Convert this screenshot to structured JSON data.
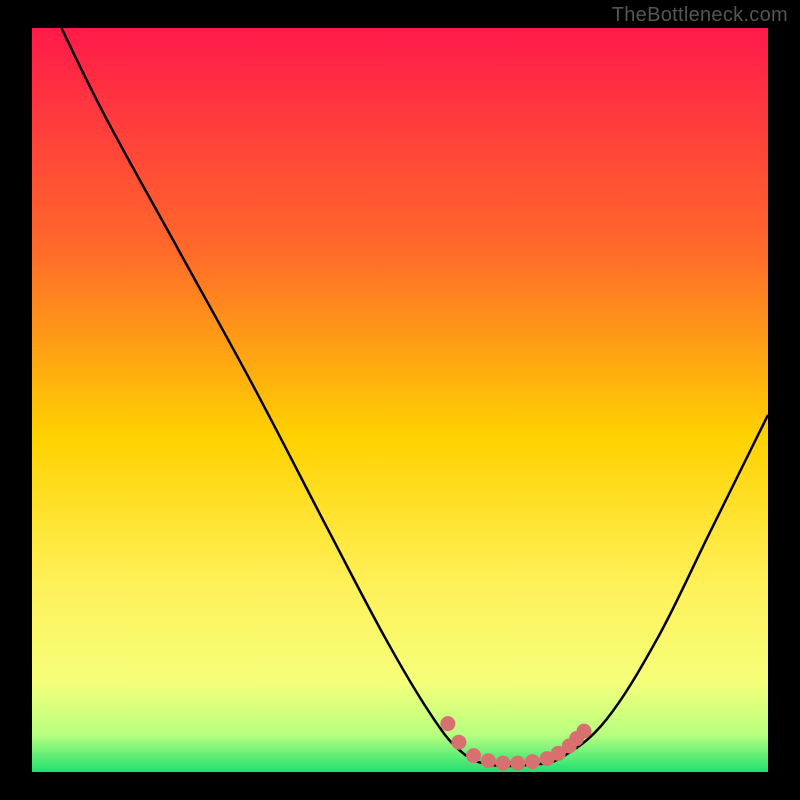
{
  "watermark": "TheBottleneck.com",
  "chart_data": {
    "type": "line",
    "title": "",
    "xlabel": "",
    "ylabel": "",
    "xlim": [
      0,
      100
    ],
    "ylim": [
      0,
      100
    ],
    "gradient_stops": [
      {
        "offset": 0,
        "color": "#ff1a4a"
      },
      {
        "offset": 30,
        "color": "#ff6a2a"
      },
      {
        "offset": 55,
        "color": "#ffd200"
      },
      {
        "offset": 75,
        "color": "#fff15a"
      },
      {
        "offset": 88,
        "color": "#f5ff7a"
      },
      {
        "offset": 95,
        "color": "#b8ff80"
      },
      {
        "offset": 100,
        "color": "#20e070"
      }
    ],
    "series": [
      {
        "name": "bottleneck-curve",
        "color": "#000000",
        "points": [
          {
            "x": 4,
            "y": 100
          },
          {
            "x": 10,
            "y": 88
          },
          {
            "x": 20,
            "y": 70
          },
          {
            "x": 30,
            "y": 52
          },
          {
            "x": 40,
            "y": 33
          },
          {
            "x": 48,
            "y": 18
          },
          {
            "x": 54,
            "y": 8
          },
          {
            "x": 58,
            "y": 3
          },
          {
            "x": 62,
            "y": 1
          },
          {
            "x": 68,
            "y": 1
          },
          {
            "x": 72,
            "y": 2
          },
          {
            "x": 78,
            "y": 7
          },
          {
            "x": 85,
            "y": 18
          },
          {
            "x": 92,
            "y": 32
          },
          {
            "x": 100,
            "y": 48
          }
        ]
      }
    ],
    "markers": [
      {
        "x": 56.5,
        "y": 6.5
      },
      {
        "x": 58,
        "y": 4
      },
      {
        "x": 60,
        "y": 2.2
      },
      {
        "x": 62,
        "y": 1.5
      },
      {
        "x": 64,
        "y": 1.2
      },
      {
        "x": 66,
        "y": 1.2
      },
      {
        "x": 68,
        "y": 1.4
      },
      {
        "x": 70,
        "y": 1.8
      },
      {
        "x": 71.5,
        "y": 2.5
      },
      {
        "x": 73,
        "y": 3.5
      },
      {
        "x": 74,
        "y": 4.5
      },
      {
        "x": 75,
        "y": 5.5
      }
    ],
    "marker_color": "#d97070",
    "annotations": []
  }
}
